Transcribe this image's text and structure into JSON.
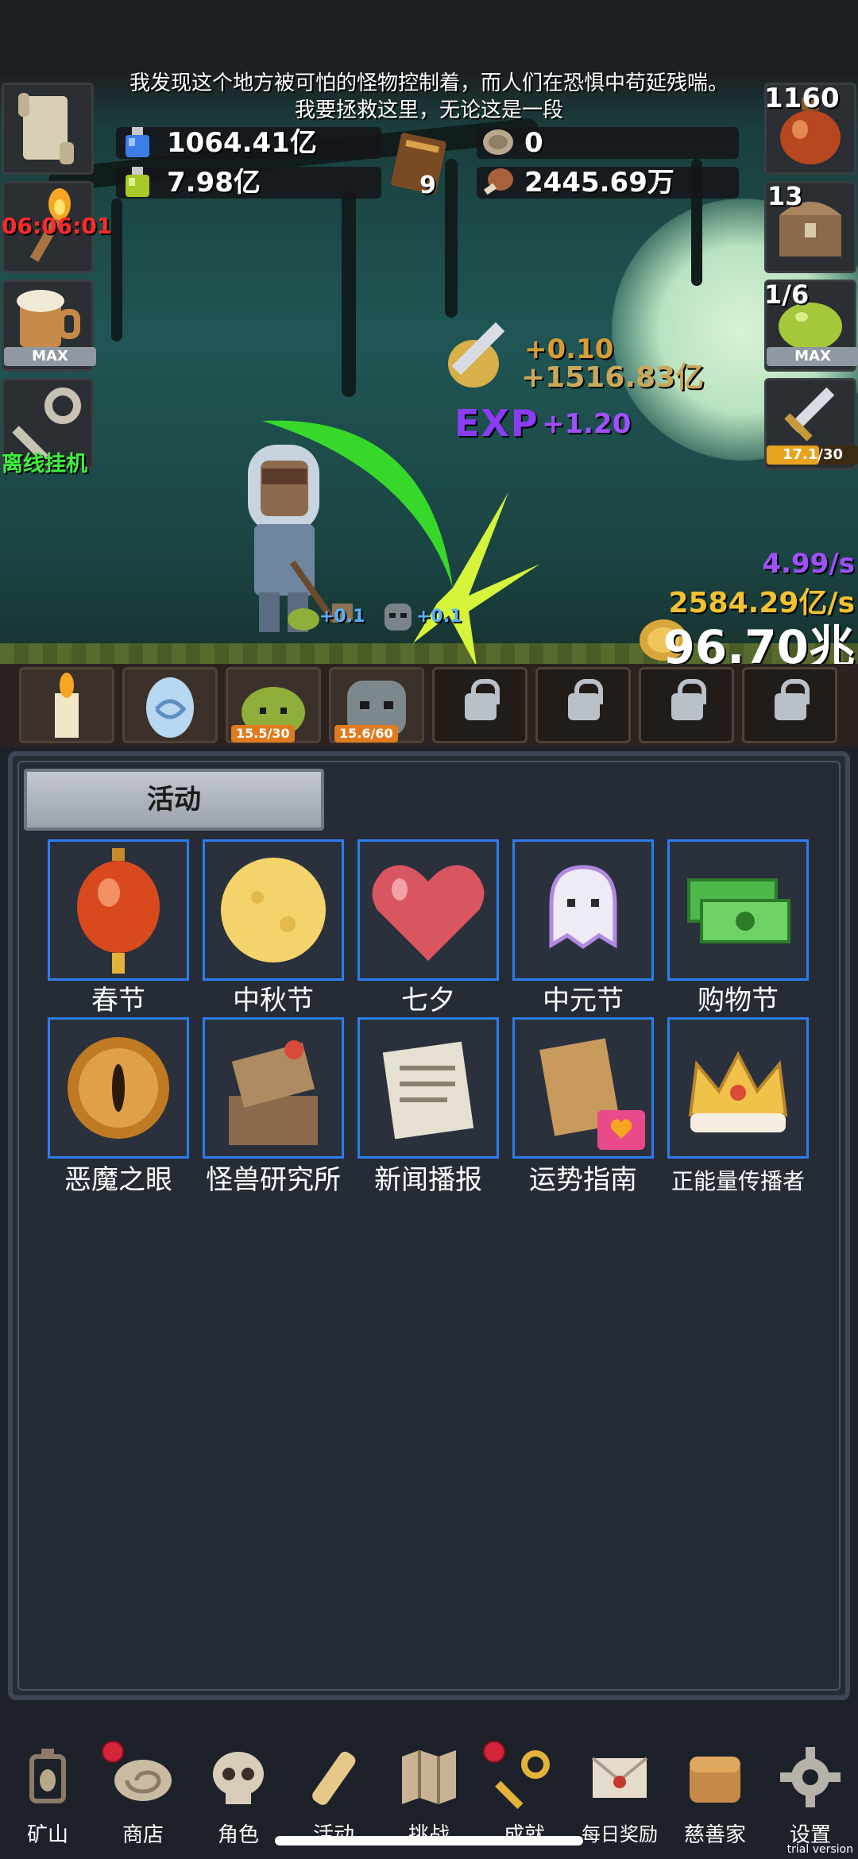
{
  "story": {
    "line1": "我发现这个地方被可怕的怪物控制着，而人们在恐惧中苟延残喘。",
    "line2": "我要拯救这里，无论这是一段"
  },
  "resources": {
    "blue_potion": "1064.41亿",
    "green_potion": "7.98亿",
    "book_count": "9",
    "coin": "0",
    "meat": "2445.69万"
  },
  "left_side": {
    "timer": "06:06:01",
    "max": "MAX",
    "offline": "离线挂机"
  },
  "right_side": {
    "potion_count": "1160",
    "chest_count": "13",
    "slime_progress": "1/6",
    "slime_max": "MAX",
    "sword_progress": "17.1/30"
  },
  "floats": {
    "gold_small": "+0.10",
    "gold_big": "+1516.83亿",
    "exp_label": "EXP",
    "exp_value": "+1.20",
    "mob1": "+0.1",
    "mob2": "+0.1"
  },
  "rates": {
    "exp_rate": "4.99/s",
    "gold_rate": "2584.29亿/s",
    "gold_total": "96.70兆"
  },
  "monster_bar": {
    "slot3_level": "15.5/30",
    "slot4_level": "15.6/60"
  },
  "panel": {
    "tab": "活动",
    "tiles": [
      {
        "label": "春节",
        "icon": "lantern-icon"
      },
      {
        "label": "中秋节",
        "icon": "moon-icon"
      },
      {
        "label": "七夕",
        "icon": "heart-icon"
      },
      {
        "label": "中元节",
        "icon": "ghost-icon"
      },
      {
        "label": "购物节",
        "icon": "cash-icon"
      },
      {
        "label": "恶魔之眼",
        "icon": "demon-eye-icon"
      },
      {
        "label": "怪兽研究所",
        "icon": "lab-icon"
      },
      {
        "label": "新闻播报",
        "icon": "news-icon"
      },
      {
        "label": "运势指南",
        "icon": "fortune-icon"
      },
      {
        "label": "正能量传播者",
        "icon": "crown-icon"
      }
    ]
  },
  "nav": [
    {
      "label": "矿山",
      "icon": "lantern-icon"
    },
    {
      "label": "商店",
      "icon": "shell-icon"
    },
    {
      "label": "角色",
      "icon": "skull-icon"
    },
    {
      "label": "活动",
      "icon": "scroll-icon"
    },
    {
      "label": "挑战",
      "icon": "map-icon"
    },
    {
      "label": "成就",
      "icon": "key-icon"
    },
    {
      "label": "每日奖励",
      "icon": "letter-icon"
    },
    {
      "label": "慈善家",
      "icon": "bread-icon"
    },
    {
      "label": "设置",
      "icon": "gear-icon"
    }
  ],
  "footer": {
    "trial": "trial version"
  },
  "colors": {
    "tile_border": "#2d7cf0",
    "timer": "#ff2a2a",
    "offline": "#3ef03e",
    "exp": "#a050ff",
    "gold": "#f2c230"
  }
}
